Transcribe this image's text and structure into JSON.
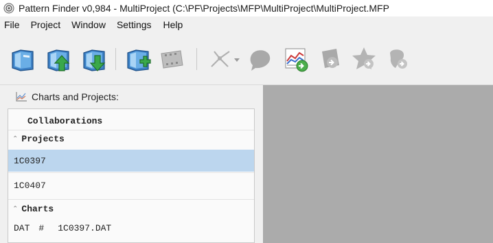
{
  "window": {
    "title": "Pattern Finder v0,984 - MultiProject (C:\\PF\\Projects\\MFP\\MultiProject\\MultiProject.MFP"
  },
  "menu": [
    "File",
    "Project",
    "Window",
    "Settings",
    "Help"
  ],
  "toolbar": {
    "icons": [
      "open-project-icon",
      "upload-project-icon",
      "download-project-icon",
      "add-chart-icon",
      "filmstrip-icon",
      "network-icon",
      "dropdown-arrow-icon",
      "blob-icon",
      "chart-export-icon",
      "export-icon",
      "star-export-icon",
      "tag-export-icon"
    ]
  },
  "panel": {
    "title": "Charts and Projects:",
    "collaborations_label": "Collaborations",
    "projects_label": "Projects",
    "projects": [
      "1C0397",
      "1C0407"
    ],
    "selected_project": "1C0397",
    "charts_label": "Charts",
    "charts": [
      {
        "type": "DAT",
        "marker": "#",
        "name": "1C0397.DAT"
      }
    ]
  }
}
